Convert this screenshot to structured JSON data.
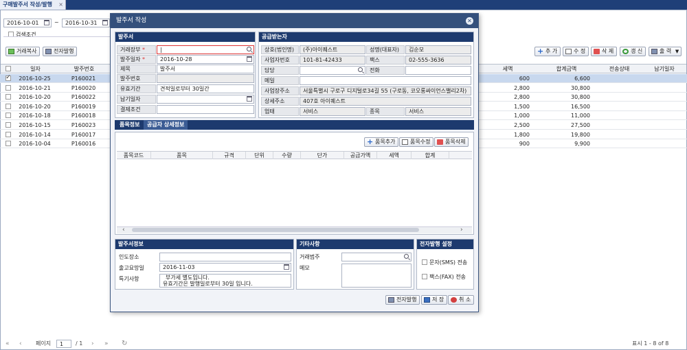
{
  "tab": {
    "title": "구매발주서 작성/발행",
    "close": "×"
  },
  "filter": {
    "date_from": "2016-10-01",
    "tilde": "~",
    "date_to": "2016-10-31",
    "search_cond": "검색조건"
  },
  "left_buttons": {
    "copy": "거래복사",
    "epublish": "전자발행"
  },
  "right_buttons": {
    "add": "추 가",
    "edit": "수 정",
    "delete": "삭 제",
    "refresh": "갱 신",
    "print": "출 력"
  },
  "grid": {
    "headers": [
      "일자",
      "발주번호",
      "세액",
      "합계금액",
      "전송상태",
      "납기일자"
    ],
    "rows": [
      {
        "date": "2016-10-25",
        "no": "P160021",
        "tax": "600",
        "total": "6,600"
      },
      {
        "date": "2016-10-21",
        "no": "P160020",
        "tax": "2,800",
        "total": "30,800"
      },
      {
        "date": "2016-10-20",
        "no": "P160022",
        "tax": "2,800",
        "total": "30,800"
      },
      {
        "date": "2016-10-20",
        "no": "P160019",
        "tax": "1,500",
        "total": "16,500"
      },
      {
        "date": "2016-10-18",
        "no": "P160018",
        "tax": "1,000",
        "total": "11,000"
      },
      {
        "date": "2016-10-15",
        "no": "P160023",
        "tax": "2,500",
        "total": "27,500"
      },
      {
        "date": "2016-10-14",
        "no": "P160017",
        "tax": "1,800",
        "total": "19,800"
      },
      {
        "date": "2016-10-04",
        "no": "P160016",
        "tax": "900",
        "total": "9,900"
      }
    ]
  },
  "pager": {
    "page_label": "페이지",
    "page": "1",
    "of": "/ 1",
    "status": "표시 1 - 8 of 8"
  },
  "modal": {
    "title": "발주서 작성",
    "po": {
      "head": "발주서",
      "client_label": "거래장부",
      "client_value": "|",
      "date_label": "발주일자",
      "date_value": "2016-10-28",
      "title_label": "제목",
      "title_value": "발주서",
      "no_label": "발주번호",
      "valid_label": "유효기간",
      "valid_value": "견적일로부터 30일간",
      "due_label": "납기일자",
      "pay_label": "결제조건"
    },
    "supplier": {
      "head": "공급받는자",
      "company_label": "상호(법인명)",
      "company_value": "(주)아이퀘스트",
      "ceo_label": "성명(대표자)",
      "ceo_value": "김순모",
      "bizno_label": "사업자번호",
      "bizno_value": "101-81-42433",
      "fax_label": "팩스",
      "fax_value": "02-555-3636",
      "manager_label": "담당",
      "phone_label": "전화",
      "email_label": "메일",
      "addr_label": "사업장주소",
      "addr_value": "서울특별시 구로구 디지털로34길 55 (구로동, 코오롱싸이언스밸리2차)",
      "addr2_label": "상세주소",
      "addr2_value": "407호 아이퀘스트",
      "biztype_label": "업태",
      "biztype_value": "서비스",
      "item_label": "종목",
      "item_value": "서비스"
    },
    "tabs": [
      "품목정보",
      "공급자 상세정보"
    ],
    "item_buttons": {
      "add": "품목추가",
      "edit": "품목수정",
      "delete": "품목삭제"
    },
    "item_headers": [
      "품목코드",
      "품목",
      "규격",
      "단위",
      "수량",
      "단가",
      "공급가액",
      "세액",
      "합계"
    ],
    "po_info": {
      "head": "발주서정보",
      "place_label": "인도장소",
      "ship_label": "출고요망일",
      "ship_value": "2016-11-03",
      "note_label": "특기사항",
      "note_line1": "부가세 별도입니다.",
      "note_line2": "유효기간은 발행일로부터 30일 입니다."
    },
    "etc": {
      "head": "기타사항",
      "category_label": "거래범주",
      "memo_label": "메모"
    },
    "epub": {
      "head": "전자발행 설정",
      "sms": "문자(SMS) 전송",
      "fax": "팩스(FAX) 전송"
    },
    "footer": {
      "epublish": "전자발행",
      "save": "저 장",
      "cancel": "취 소"
    }
  }
}
